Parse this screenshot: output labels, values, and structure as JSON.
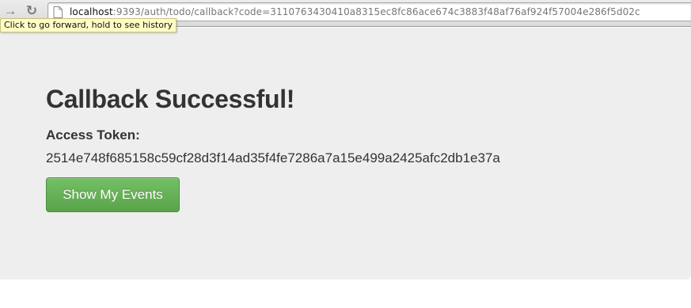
{
  "browser": {
    "forward_icon": "→",
    "reload_icon": "↻",
    "url_host": "localhost",
    "url_rest": ":9393/auth/todo/callback?code=3110763430410a8315ec8fc86ace674c3883f48af76af924f57004e286f5d02c",
    "forward_tooltip": "Click to go forward, hold to see history"
  },
  "main": {
    "title": "Callback Successful!",
    "token_label": "Access Token:",
    "token_value": "2514e748f685158c59cf28d3f14ad35f4fe7286a7a15e499a2425afc2db1e37a",
    "button_label": "Show My Events",
    "button_color": "#62ae53"
  }
}
